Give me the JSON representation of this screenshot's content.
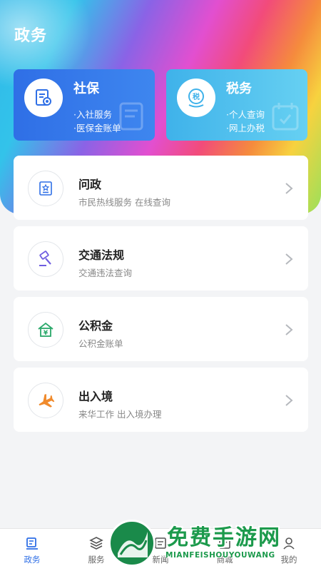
{
  "header": {
    "title": "政务"
  },
  "top_cards": [
    {
      "title": "社保",
      "lines": [
        "·入社服务",
        "·医保金账单"
      ],
      "icon": "document-seal-icon"
    },
    {
      "title": "税务",
      "lines": [
        "·个人查询",
        "·网上办税"
      ],
      "icon": "tax-stamp-icon"
    }
  ],
  "list": [
    {
      "title": "问政",
      "subtitle": "市民热线服务 在线查询",
      "icon": "badge-star-icon"
    },
    {
      "title": "交通法规",
      "subtitle": "交通违法查询",
      "icon": "gavel-icon"
    },
    {
      "title": "公积金",
      "subtitle": "公积金账单",
      "icon": "house-yuan-icon"
    },
    {
      "title": "出入境",
      "subtitle": "来华工作 出入境办理",
      "icon": "airplane-icon"
    }
  ],
  "tabbar": {
    "tabs": [
      {
        "label": "政务",
        "active": true
      },
      {
        "label": "服务",
        "active": false
      },
      {
        "label": "新闻",
        "active": false
      },
      {
        "label": "商城",
        "active": false
      },
      {
        "label": "我的",
        "active": false
      }
    ]
  },
  "watermark": {
    "cn": "免费手游网",
    "en": "MIANFEISHOUYOUWANG"
  },
  "colors": {
    "primary": "#2f6fe6",
    "tax_card": "#4ec0ee",
    "background": "#f3f4f6"
  }
}
